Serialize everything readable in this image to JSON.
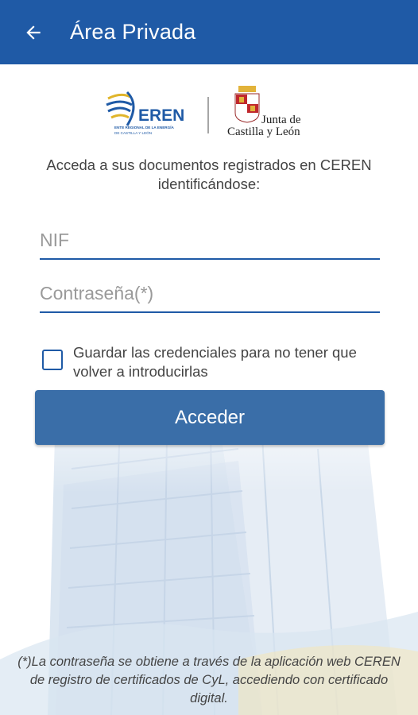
{
  "appbar": {
    "title": "Área Privada",
    "back_icon": "arrow-left-icon",
    "color": "#1f5aa6"
  },
  "logos": {
    "eren_name": "EREN",
    "eren_tagline": "ENTE REGIONAL DE LA ENERGÍA",
    "eren_sub": "DE CASTILLA Y LEÓN",
    "jcyl_line1": "Junta de",
    "jcyl_line2": "Castilla y León"
  },
  "intro": {
    "text": "Acceda a sus documentos registrados en CEREN identificándose:"
  },
  "form": {
    "nif_placeholder": "NIF",
    "nif_value": "",
    "password_placeholder": "Contraseña(*)",
    "password_value": "",
    "remember_label": "Guardar las credenciales para no tener que volver a introducirlas",
    "remember_checked": false,
    "submit_label": "Acceder"
  },
  "footnote": {
    "text": "(*)La contraseña se obtiene a través de la aplicación web CEREN de registro de certificados de CyL, accediendo con certificado digital."
  }
}
